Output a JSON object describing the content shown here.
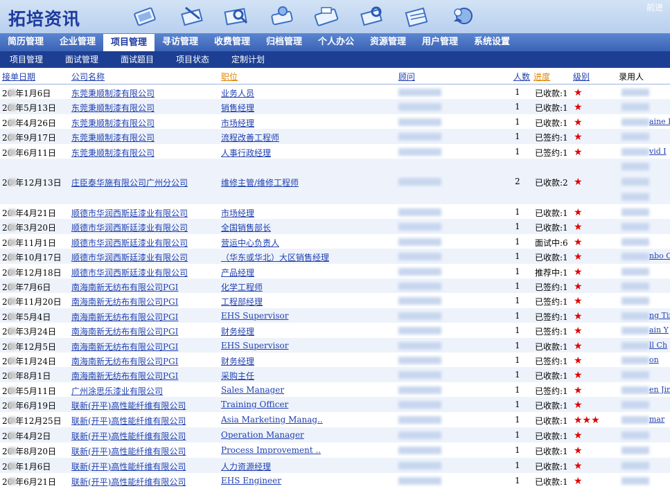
{
  "app_title": "拓培资讯",
  "forward_link": "前进",
  "toolbar_icons": [
    "resume-toolbar-icon",
    "edit-toolbar-icon",
    "search-toolbar-icon",
    "message-toolbar-icon",
    "fax-toolbar-icon",
    "tools-toolbar-icon",
    "calendar-toolbar-icon",
    "globe-user-toolbar-icon"
  ],
  "nav_primary": [
    "简历管理",
    "企业管理",
    "项目管理",
    "寻访管理",
    "收费管理",
    "归档管理",
    "个人办公",
    "资源管理",
    "用户管理",
    "系统设置"
  ],
  "nav_primary_active": "项目管理",
  "nav_secondary": [
    "项目管理",
    "面试管理",
    "面试题目",
    "项目状态",
    "定制计划"
  ],
  "columns": {
    "date": "接单日期",
    "company": "公司名称",
    "position": "职位",
    "consultant": "顾问",
    "count": "人数",
    "progress": "进度",
    "level": "级别",
    "hire": "录用人"
  },
  "rows": [
    {
      "date": "20  年1月6日",
      "company": "东莞秉顺制漆有限公司",
      "position": "业务人员",
      "count": "1",
      "progress": "已收款:1",
      "stars": "★",
      "hire_tail": ""
    },
    {
      "date": "20  年5月13日",
      "company": "东莞秉顺制漆有限公司",
      "position": "销售经理",
      "count": "1",
      "progress": "已收款:1",
      "stars": "★",
      "hire_tail": ""
    },
    {
      "date": "20  年4月26日",
      "company": "东莞秉顺制漆有限公司",
      "position": "市场经理",
      "count": "1",
      "progress": "已收款:1",
      "stars": "★",
      "hire_tail": "aine I"
    },
    {
      "date": "20  年9月17日",
      "company": "东莞秉顺制漆有限公司",
      "position": "流程改善工程师",
      "count": "1",
      "progress": "已签约:1",
      "stars": "★",
      "hire_tail": ""
    },
    {
      "date": "20  年6月11日",
      "company": "东莞秉顺制漆有限公司",
      "position": "人事行政经理",
      "count": "1",
      "progress": "已签约:1",
      "stars": "★",
      "hire_tail": "vid I"
    },
    {
      "date": "20  年12月13日",
      "company": "庄臣泰华施有限公司广州分公司",
      "position": "维修主管/维修工程师",
      "count": "2",
      "progress": "已收款:2",
      "stars": "★",
      "hire_tail": ""
    },
    {
      "date": "20  年4月21日",
      "company": "顺德市华润西斯廷漆业有限公司",
      "position": "市场经理",
      "count": "1",
      "progress": "已收款:1",
      "stars": "★",
      "hire_tail": ""
    },
    {
      "date": "20  年3月20日",
      "company": "顺德市华润西斯廷漆业有限公司",
      "position": "全国销售部长",
      "count": "1",
      "progress": "已收款:1",
      "stars": "★",
      "hire_tail": ""
    },
    {
      "date": "20  年11月1日",
      "company": "顺德市华润西斯廷漆业有限公司",
      "position": "营运中心负责人",
      "count": "1",
      "progress": "面试中:6",
      "stars": "★",
      "hire_tail": ""
    },
    {
      "date": "20  年10月17日",
      "company": "顺德市华润西斯廷漆业有限公司",
      "position": "（华东或华北）大区销售经理",
      "count": "1",
      "progress": "已收款:1",
      "stars": "★",
      "hire_tail": "nbo C"
    },
    {
      "date": "20  年12月18日",
      "company": "顺德市华润西斯廷漆业有限公司",
      "position": "产品经理",
      "count": "1",
      "progress": "推荐中:1",
      "stars": "★",
      "hire_tail": ""
    },
    {
      "date": "20  年7月6日",
      "company": "南海南新无纺布有限公司PGI",
      "position": "化学工程师",
      "count": "1",
      "progress": "已签约:1",
      "stars": "★",
      "hire_tail": ""
    },
    {
      "date": "20  年11月20日",
      "company": "南海南新无纺布有限公司PGI",
      "position": "工程部经理",
      "count": "1",
      "progress": "已签约:1",
      "stars": "★",
      "hire_tail": ""
    },
    {
      "date": "20  年5月4日",
      "company": "南海南新无纺布有限公司PGI",
      "position": "EHS Supervisor",
      "count": "1",
      "progress": "已签约:1",
      "stars": "★",
      "hire_tail": "ng Tin"
    },
    {
      "date": "20  年3月24日",
      "company": "南海南新无纺布有限公司PGI",
      "position": "财务经理",
      "count": "1",
      "progress": "已签约:1",
      "stars": "★",
      "hire_tail": "ain Y"
    },
    {
      "date": "20  年12月5日",
      "company": "南海南新无纺布有限公司PGI",
      "position": "EHS Supervisor",
      "count": "1",
      "progress": "已收款:1",
      "stars": "★",
      "hire_tail": "ll Ch"
    },
    {
      "date": "20  年1月24日",
      "company": "南海南新无纺布有限公司PGI",
      "position": "财务经理",
      "count": "1",
      "progress": "已签约:1",
      "stars": "★",
      "hire_tail": "on"
    },
    {
      "date": "20  年8月1日",
      "company": "南海南新无纺布有限公司PGI",
      "position": "采购主任",
      "count": "1",
      "progress": "已收款:1",
      "stars": "★",
      "hire_tail": ""
    },
    {
      "date": "20  年5月11日",
      "company": "广州涂思乐漆业有限公司",
      "position": "Sales Manager",
      "count": "1",
      "progress": "已签约:1",
      "stars": "★",
      "hire_tail": "en Jin"
    },
    {
      "date": "20  年6月19日",
      "company": "联新(开平)高性能纤维有限公司",
      "position": "Training Officer",
      "count": "1",
      "progress": "已收款:1",
      "stars": "★",
      "hire_tail": ""
    },
    {
      "date": "20  年12月25日",
      "company": "联新(开平)高性能纤维有限公司",
      "position": "Asia Marketing Manag..",
      "count": "1",
      "progress": "已收款:1",
      "stars": "★★★",
      "hire_tail": "mar"
    },
    {
      "date": "20  年4月2日",
      "company": "联新(开平)高性能纤维有限公司",
      "position": "Operation Manager",
      "count": "1",
      "progress": "已收款:1",
      "stars": "★",
      "hire_tail": ""
    },
    {
      "date": "20  年8月20日",
      "company": "联新(开平)高性能纤维有限公司",
      "position": "Process Improvement ..",
      "count": "1",
      "progress": "已收款:1",
      "stars": "★",
      "hire_tail": ""
    },
    {
      "date": "20  年1月6日",
      "company": "联新(开平)高性能纤维有限公司",
      "position": "人力资源经理",
      "count": "1",
      "progress": "已收款:1",
      "stars": "★",
      "hire_tail": ""
    },
    {
      "date": "20  年6月21日",
      "company": "联新(开平)高性能纤维有限公司",
      "position": "EHS Engineer",
      "count": "1",
      "progress": "已收款:1",
      "stars": "★",
      "hire_tail": ""
    }
  ]
}
